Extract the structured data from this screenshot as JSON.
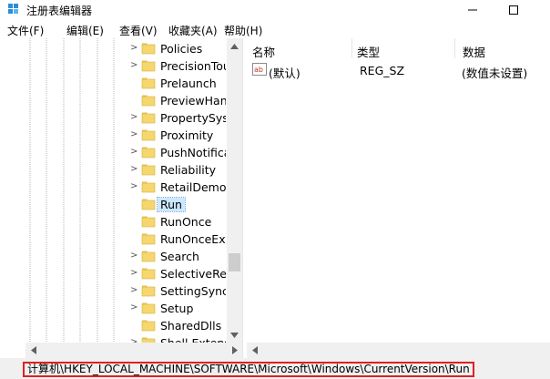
{
  "window": {
    "title": "注册表编辑器",
    "minimize_icon": "minimize-icon",
    "maximize_icon": "maximize-icon"
  },
  "menu": {
    "items": [
      "文件(F)",
      "编辑(E)",
      "查看(V)",
      "收藏夹(A)",
      "帮助(H)"
    ]
  },
  "tree": {
    "items": [
      {
        "label": "Policies",
        "expandable": true
      },
      {
        "label": "PrecisionTou",
        "expandable": true
      },
      {
        "label": "Prelaunch",
        "expandable": false
      },
      {
        "label": "PreviewHand",
        "expandable": false
      },
      {
        "label": "PropertySyst",
        "expandable": true
      },
      {
        "label": "Proximity",
        "expandable": true
      },
      {
        "label": "PushNotificat",
        "expandable": true
      },
      {
        "label": "Reliability",
        "expandable": true
      },
      {
        "label": "RetailDemo",
        "expandable": true
      },
      {
        "label": "Run",
        "expandable": false,
        "selected": true
      },
      {
        "label": "RunOnce",
        "expandable": false
      },
      {
        "label": "RunOnceEx",
        "expandable": false
      },
      {
        "label": "Search",
        "expandable": true
      },
      {
        "label": "SelectiveRem",
        "expandable": true
      },
      {
        "label": "SettingSync",
        "expandable": true
      },
      {
        "label": "Setup",
        "expandable": true
      },
      {
        "label": "SharedDlls",
        "expandable": false
      },
      {
        "label": "Shell Extensio",
        "expandable": true
      }
    ]
  },
  "values": {
    "columns": {
      "name": "名称",
      "type": "类型",
      "data": "数据"
    },
    "rows": [
      {
        "name": "(默认)",
        "type": "REG_SZ",
        "data": "(数值未设置)"
      }
    ]
  },
  "status": {
    "path": "计算机\\HKEY_LOCAL_MACHINE\\SOFTWARE\\Microsoft\\Windows\\CurrentVersion\\Run"
  },
  "colors": {
    "folder": "#f5d76e",
    "selection": "#cce8ff",
    "highlight_border": "#e02020"
  }
}
